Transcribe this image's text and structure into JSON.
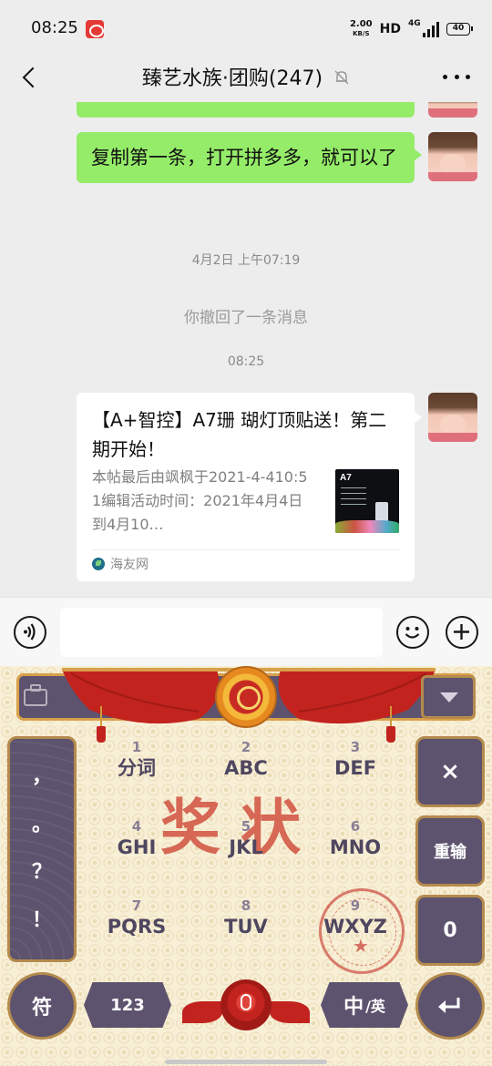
{
  "status_bar": {
    "time": "08:25",
    "net_speed": "2.00",
    "net_unit": "KB/S",
    "hd": "HD",
    "network": "4G",
    "battery": "40"
  },
  "nav": {
    "title": "臻艺水族·团购(247)"
  },
  "chat": {
    "messages": [
      {
        "text": "复制第一条，打开拼多多，就可以了"
      }
    ],
    "timestamp1": "4月2日 上午07:19",
    "recall_notice": "你撤回了一条消息",
    "timestamp2": "08:25",
    "card": {
      "title": "【A+智控】A7珊 瑚灯顶贴送！第二期开始！",
      "desc": "本帖最后由飒枫于2021-4-410:51编辑活动时间：2021年4月4日到4月10…",
      "thumb_label": "A7",
      "source": "海友网"
    }
  },
  "input_bar": {
    "value": ""
  },
  "keyboard": {
    "stamp_text": "奖状",
    "punctuation": [
      "，",
      "。",
      "？",
      "！"
    ],
    "keys": [
      {
        "num": "1",
        "label": "分词"
      },
      {
        "num": "2",
        "label": "ABC"
      },
      {
        "num": "3",
        "label": "DEF"
      },
      {
        "num": "4",
        "label": "GHI"
      },
      {
        "num": "5",
        "label": "JKL"
      },
      {
        "num": "6",
        "label": "MNO"
      },
      {
        "num": "7",
        "label": "PQRS"
      },
      {
        "num": "8",
        "label": "TUV"
      },
      {
        "num": "9",
        "label": "WXYZ"
      }
    ],
    "delete_label": "×",
    "reenter_label": "重输",
    "zero_label": "0",
    "symbol_label": "符",
    "num_label": "123",
    "lang_big": "中",
    "lang_small": "/英",
    "colors": {
      "key": "#5d536e",
      "border": "#b48a4d",
      "accent": "#c2231e",
      "bg": "#f8efd7"
    }
  },
  "colors": {
    "bubble": "#95ec69",
    "background": "#ededed"
  }
}
